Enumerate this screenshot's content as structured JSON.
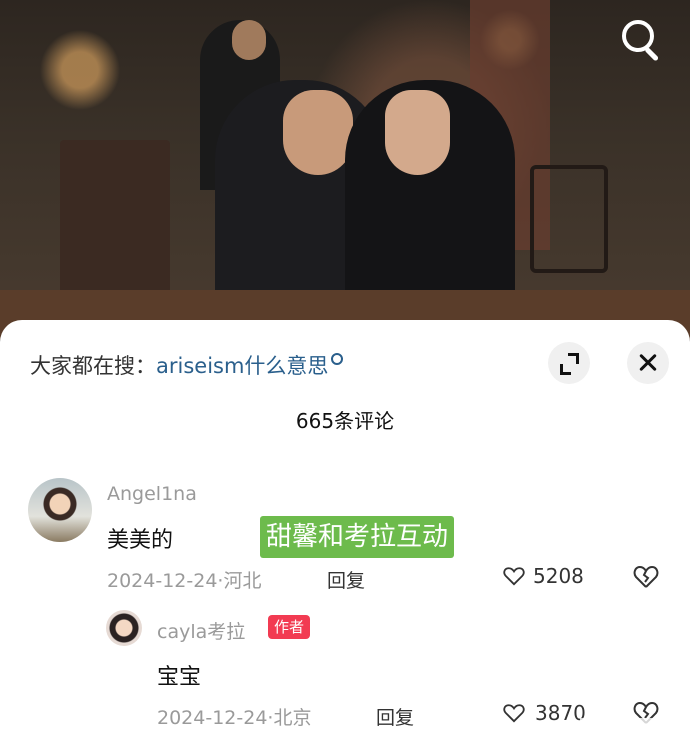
{
  "search_suggest": {
    "prefix": "大家都在搜：",
    "term": "ariseism什么意思"
  },
  "comment_count": "665条评论",
  "comments": [
    {
      "user": "Angel1na",
      "text": "美美的",
      "date": "2024-12-24",
      "location": "河北",
      "reply": "回复",
      "likes": "5208"
    },
    {
      "user": "cayla考拉",
      "badge": "作者",
      "text": "宝宝",
      "date": "2024-12-24",
      "location": "北京",
      "reply": "回复",
      "likes": "3870"
    }
  ],
  "overlay_caption": "甜馨和考拉互动",
  "icons": {
    "search": "search-icon",
    "expand": "expand-icon",
    "close": "close-icon",
    "like": "heart-icon",
    "dislike": "broken-heart-icon"
  },
  "colors": {
    "accent_link": "#2a5f8c",
    "author_badge": "#f23b52",
    "caption_bg": "#6dbb4c"
  }
}
